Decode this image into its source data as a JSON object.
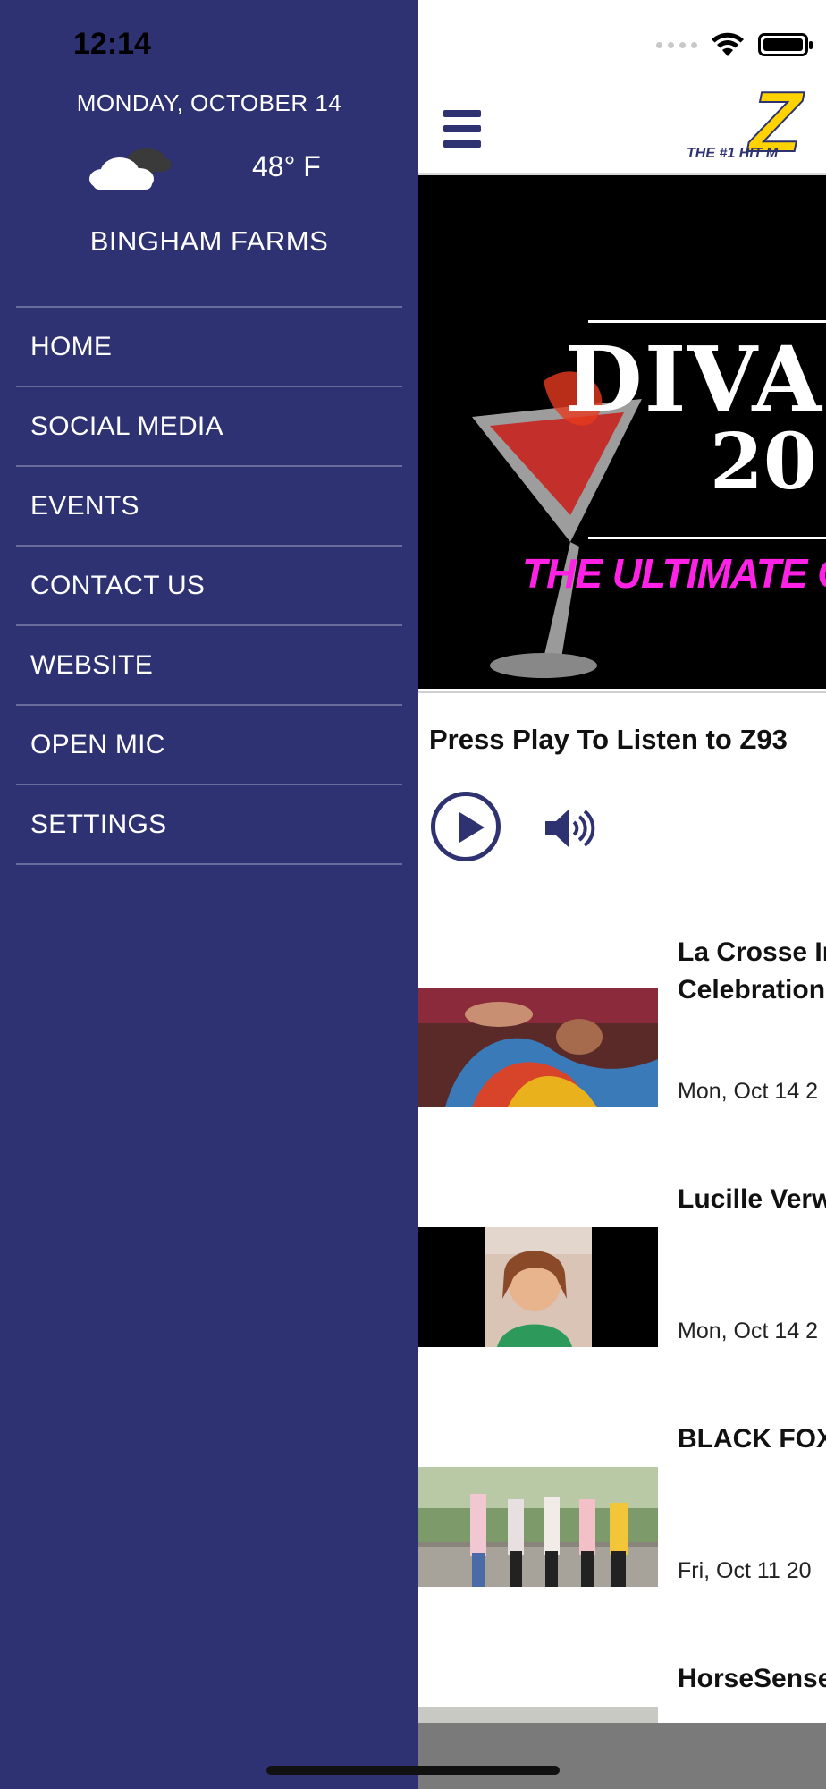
{
  "status_bar": {
    "time": "12:14"
  },
  "drawer": {
    "date": "MONDAY, OCTOBER 14",
    "temperature": "48° F",
    "weather_icon": "cloudy-icon",
    "location": "BINGHAM FARMS",
    "menu": [
      {
        "label": "HOME"
      },
      {
        "label": "SOCIAL MEDIA"
      },
      {
        "label": "EVENTS"
      },
      {
        "label": "CONTACT US"
      },
      {
        "label": "WEBSITE"
      },
      {
        "label": "OPEN MIC"
      },
      {
        "label": "SETTINGS"
      }
    ]
  },
  "header": {
    "logo_letter": "Z",
    "logo_tagline": "THE #1 HIT M"
  },
  "banner": {
    "line1": "DIVA",
    "line2": "20",
    "subtitle": "THE ULTIMATE G"
  },
  "player": {
    "title": "Press Play To Listen to Z93"
  },
  "news": [
    {
      "title_line1": "La Crosse In",
      "title_line2": "Celebration",
      "date": "Mon, Oct 14 2"
    },
    {
      "title_line1": "Lucille Verw",
      "title_line2": "",
      "date": "Mon, Oct 14 2"
    },
    {
      "title_line1": "BLACK FOX",
      "title_line2": "",
      "date": "Fri, Oct 11 20"
    },
    {
      "title_line1": "HorseSense",
      "title_line2": "",
      "date": ""
    }
  ],
  "colors": {
    "brand": "#2e3172",
    "accent": "#ffd200",
    "banner_magenta": "#ff22e6"
  }
}
